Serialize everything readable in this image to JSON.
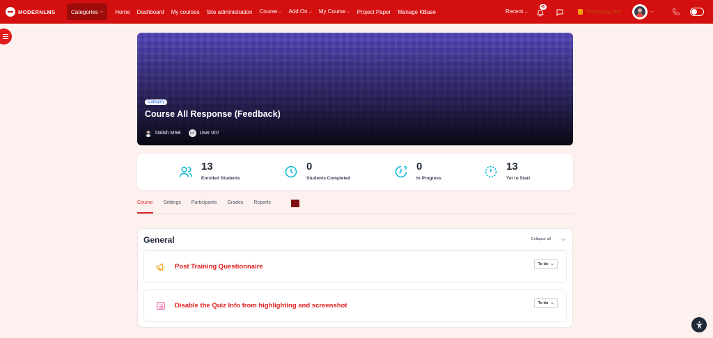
{
  "brand": {
    "logo_text": "MODERNLMS"
  },
  "nav": {
    "categories_label": "Categories",
    "items": [
      "Home",
      "Dashboard",
      "My courses",
      "Site administration",
      "Course",
      "Add On",
      "My Course",
      "Project Paper",
      "Manage KBase"
    ],
    "dropdown_flags": [
      false,
      false,
      false,
      false,
      true,
      true,
      true,
      false,
      false
    ],
    "recent_label": "Recent",
    "notification_count": "45",
    "course_tag": "Psychology Test"
  },
  "hero": {
    "category": "Category",
    "title": "Course All Response (Feedback)",
    "teacher": "Dalish MSB",
    "user_initials": "U0",
    "user": "User 007"
  },
  "stats": [
    {
      "value": "13",
      "label": "Enrolled Students",
      "icon": "users-icon"
    },
    {
      "value": "0",
      "label": "Students Completed",
      "icon": "clock-icon"
    },
    {
      "value": "0",
      "label": "In Progress",
      "icon": "progress-clock-icon"
    },
    {
      "value": "13",
      "label": "Yet to Start",
      "icon": "timer-icon"
    }
  ],
  "tabs": [
    "Course",
    "Settings",
    "Participants",
    "Grades",
    "Reports"
  ],
  "section": {
    "title": "General",
    "collapse_label": "Collapse all",
    "activities": [
      {
        "title": "Post Training Questionnaire",
        "status": "To do",
        "icon": "megaphone-icon"
      },
      {
        "title": "Disable the Quiz Info from highlighting and screenshot",
        "status": "To do",
        "icon": "page-icon"
      }
    ]
  },
  "colors": {
    "navbar": "#d40f0f",
    "accent": "#dc2626",
    "hero": "#4c3fb0",
    "stat_icon": "#06b6d4"
  }
}
